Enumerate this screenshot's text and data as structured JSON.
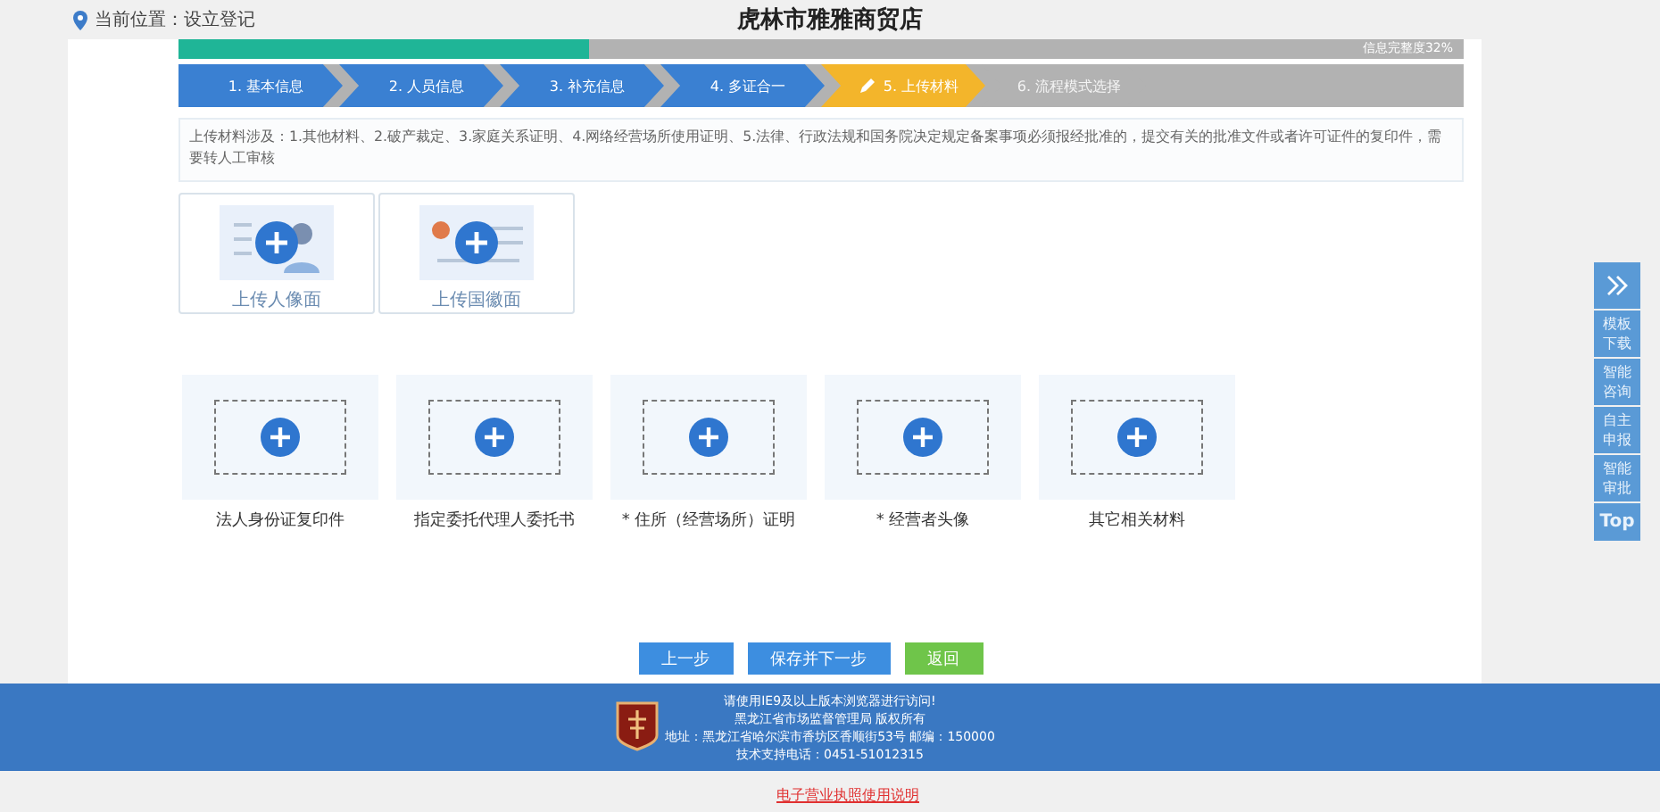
{
  "location": "当前位置：设立登记",
  "title": "虎林市雅雅商贸店",
  "progress": {
    "level": 0.32,
    "label": "信息完整度32%"
  },
  "steps": [
    {
      "label": "1. 基本信息",
      "completed": true,
      "selected": false
    },
    {
      "label": "2. 人员信息",
      "completed": true,
      "selected": false
    },
    {
      "label": "3. 补充信息",
      "completed": true,
      "selected": false
    },
    {
      "label": "4. 多证合一",
      "completed": true,
      "selected": false
    },
    {
      "label": "5. 上传材料",
      "completed": false,
      "selected": true
    },
    {
      "label": "6. 流程模式选择",
      "completed": false,
      "selected": false
    }
  ],
  "notice": "上传材料涉及：1.其他材料、2.破产裁定、3.家庭关系证明、4.网络经营场所使用证明、5.法律、行政法规和国务院决定规定备案事项必须报经批准的，提交有关的批准文件或者许可证件的复印件，需要转人工审核",
  "id_cards": [
    {
      "label": "上传人像面",
      "kind": "portrait"
    },
    {
      "label": "上传国徽面",
      "kind": "emblem"
    }
  ],
  "uploads": [
    {
      "label": "法人身份证复印件"
    },
    {
      "label": "指定委托代理人委托书"
    },
    {
      "label": "* 住所（经营场所）证明"
    },
    {
      "label": "* 经营者头像"
    },
    {
      "label": "其它相关材料"
    }
  ],
  "buttons": [
    {
      "label": "上一步",
      "kind": "primary"
    },
    {
      "label": "保存并下一步",
      "kind": "primary"
    },
    {
      "label": "返回",
      "kind": "back"
    }
  ],
  "side_tools": [
    {
      "label": "模板下载"
    },
    {
      "label": "智能咨询"
    },
    {
      "label": "自主申报"
    },
    {
      "label": "智能审批"
    },
    {
      "label": "Top",
      "kind": "top"
    }
  ],
  "footer": {
    "lines": [
      "请使用IE9及以上版本浏览器进行访问!",
      "黑龙江省市场监督管理局 版权所有",
      "地址：黑龙江省哈尔滨市香坊区香顺街53号 邮编：150000",
      "技术支持电话：0451-51012315"
    ],
    "link": "电子营业执照使用说明"
  }
}
